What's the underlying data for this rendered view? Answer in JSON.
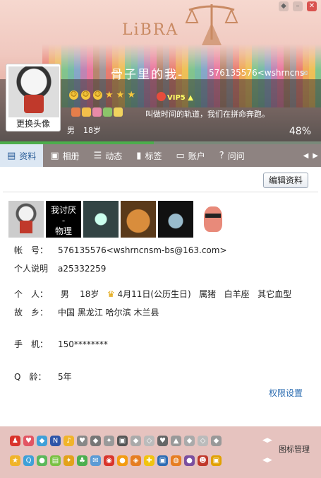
{
  "header": {
    "logo_text": "LiBRA",
    "nickname": "骨子里的我-",
    "uid_email": "576135576<wshrncns",
    "signature": "叫做时间的轨道，我们在拼命奔跑。",
    "gender": "男",
    "age": "18岁",
    "percent": "48%",
    "progress_fraction": 0.48,
    "vip_label": "VIP5",
    "change_avatar": "更换头像"
  },
  "tabs": [
    {
      "label": "资料",
      "icon": "profile-card-icon",
      "active": true
    },
    {
      "label": "相册",
      "icon": "photo-icon",
      "active": false
    },
    {
      "label": "动态",
      "icon": "list-icon",
      "active": false
    },
    {
      "label": "标签",
      "icon": "bookmark-icon",
      "active": false
    },
    {
      "label": "账户",
      "icon": "wallet-icon",
      "active": false
    },
    {
      "label": "问问",
      "icon": "question-icon",
      "active": false
    }
  ],
  "content": {
    "edit_button": "编辑资料",
    "photo2_line1": "我讨厌",
    "photo2_line2": "-",
    "photo2_line3": "物理",
    "account_label": "帐　号：",
    "account_value": "576135576<wshrncnsm-bs@163.com>",
    "desc_label": "个人说明",
    "desc_value": "a25332259",
    "personal_label": "个　人：",
    "personal_gender": "男",
    "personal_age": "18岁",
    "personal_birthday": "4月11日(公历生日)",
    "personal_zodiac": "属猪",
    "personal_sign": "白羊座",
    "personal_blood": "其它血型",
    "hometown_label": "故　乡：",
    "hometown_value": "中国 黑龙江 哈尔滨 木兰县",
    "phone_label": "手　机：",
    "phone_value": "150********",
    "qage_label": "Q　龄：",
    "qage_value": "5年",
    "permissions_link": "权限设置"
  },
  "iconbar": {
    "manage_label": "图标管理"
  },
  "colors": {
    "tab_active_bg": "#dce7f3",
    "tab_bar_bg": "#8e8381",
    "link": "#2a6bb0",
    "progress": "#4cae4c",
    "iconbar_bg": "#e6c3bf"
  }
}
